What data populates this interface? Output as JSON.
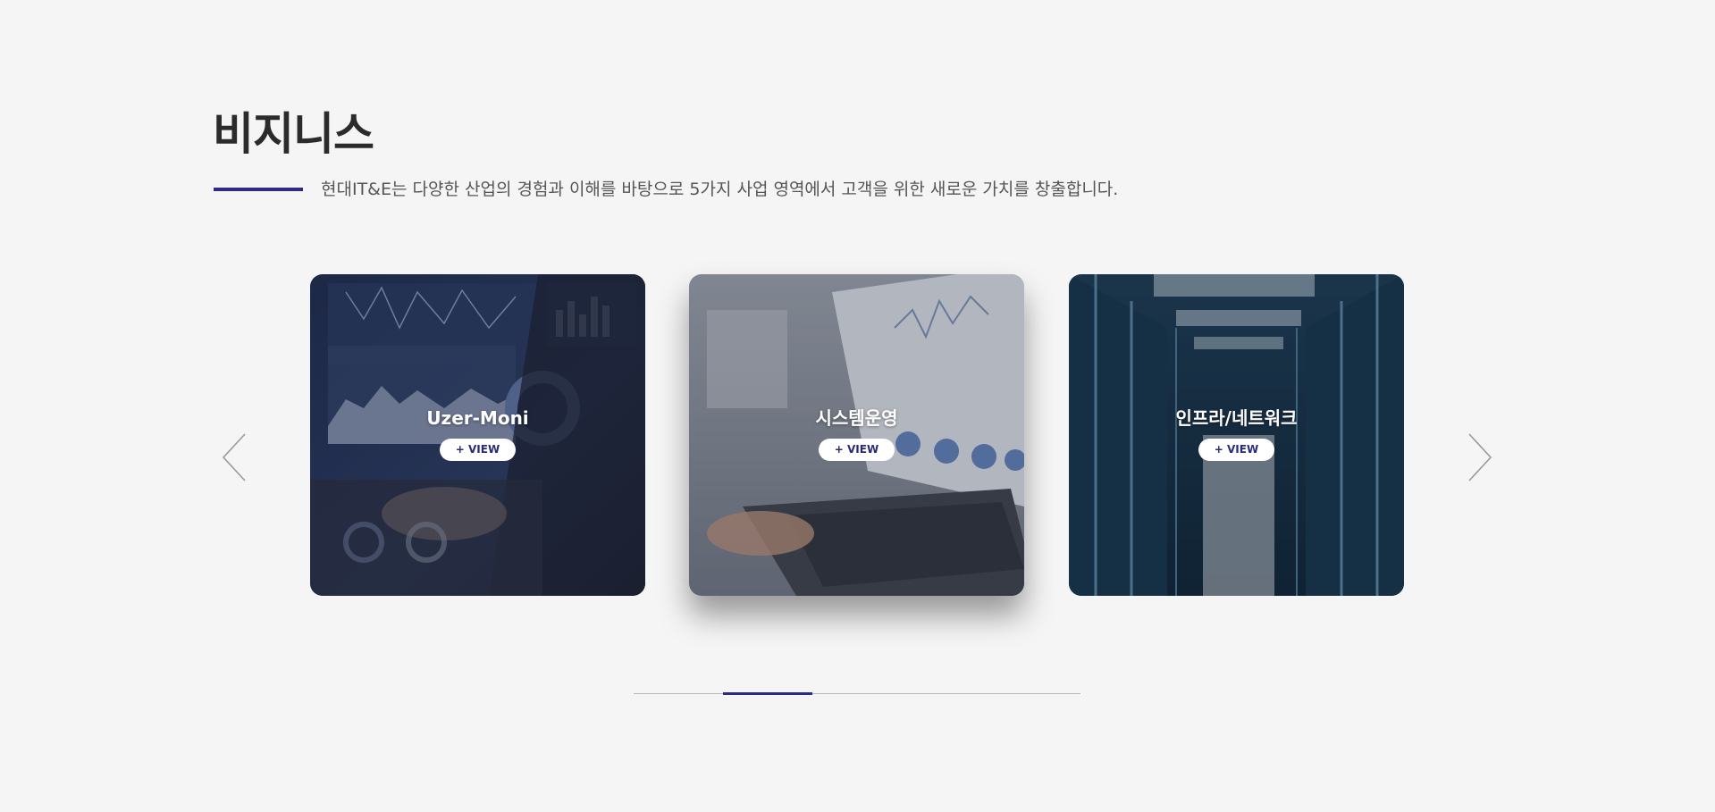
{
  "section": {
    "title": "비지니스",
    "subtitle": "현대IT&E는 다양한 산업의 경험과 이해를 바탕으로 5가지 사업 영역에서 고객을 위한 새로운 가치를 창출합니다."
  },
  "carousel": {
    "prev_icon": "chevron-left-icon",
    "next_icon": "chevron-right-icon",
    "cards": [
      {
        "title": "Uzer-Moni",
        "view_label": "+ VIEW",
        "image": "analytics-dashboard-laptop-image"
      },
      {
        "title": "시스템운영",
        "view_label": "+ VIEW",
        "image": "laptop-charts-image"
      },
      {
        "title": "인프라/네트워크",
        "view_label": "+ VIEW",
        "image": "server-room-image"
      }
    ],
    "active_index": 1,
    "total_pages": 5
  },
  "colors": {
    "accent": "#2e2a86",
    "background": "#f5f5f5",
    "title": "#2b2b2b"
  }
}
